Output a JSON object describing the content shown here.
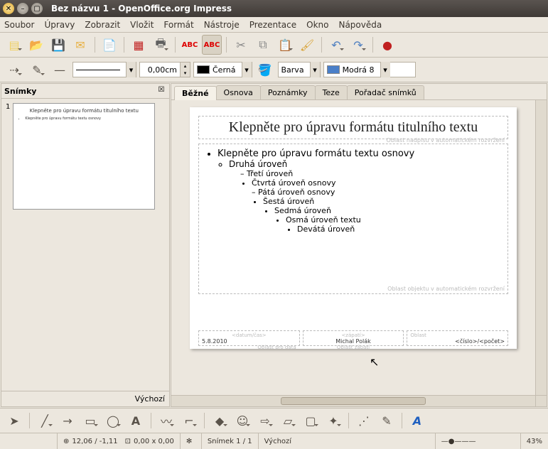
{
  "window": {
    "title": "Bez názvu 1 - OpenOffice.org Impress"
  },
  "menu": {
    "items": [
      "Soubor",
      "Úpravy",
      "Zobrazit",
      "Vložit",
      "Formát",
      "Nástroje",
      "Prezentace",
      "Okno",
      "Nápověda"
    ]
  },
  "toolbar2": {
    "width_value": "0,00cm",
    "color_label": "Černá",
    "fill_label": "Barva",
    "fill_color": "Modrá 8"
  },
  "slides_panel": {
    "title": "Snímky",
    "slide_number": "1",
    "layout_name": "Výchozí"
  },
  "tabs": {
    "items": [
      "Běžné",
      "Osnova",
      "Poznámky",
      "Teze",
      "Pořadač snímků"
    ],
    "active": 0
  },
  "slide": {
    "title": "Klepněte pro úpravu formátu titulního textu",
    "hint_top": "Oblast nadpisu v automatickém rozvržení",
    "bullets": {
      "l1": "Klepněte pro úpravu formátu textu osnovy",
      "l2": "Druhá úroveň",
      "l3": "Třetí úroveň",
      "l4": "Čtvrtá úroveň osnovy",
      "l5": "Pátá úroveň osnovy",
      "l6": "Šestá úroveň",
      "l7": "Sedmá úroveň",
      "l8": "Osmá úroveň textu",
      "l9": "Devátá úroveň"
    },
    "hint_body": "Oblast objektu v automatickém rozvržení",
    "footer": {
      "date_ph": "<datum/čas>",
      "date_val": "5.8.2010",
      "date_hint": "Oblast pro data",
      "center_ph": "<zápatí>",
      "center_val": "Michal Polák",
      "center_hint": "Oblast zápatí",
      "num_ph": "<číslo>",
      "num_hint": "Oblast",
      "num_val": "<číslo>/<počet>"
    }
  },
  "status": {
    "coords": "12,06 / -1,11",
    "size": "0,00 x 0,00",
    "slide_counter": "Snímek 1 / 1",
    "master": "Výchozí",
    "zoom": "43%"
  }
}
